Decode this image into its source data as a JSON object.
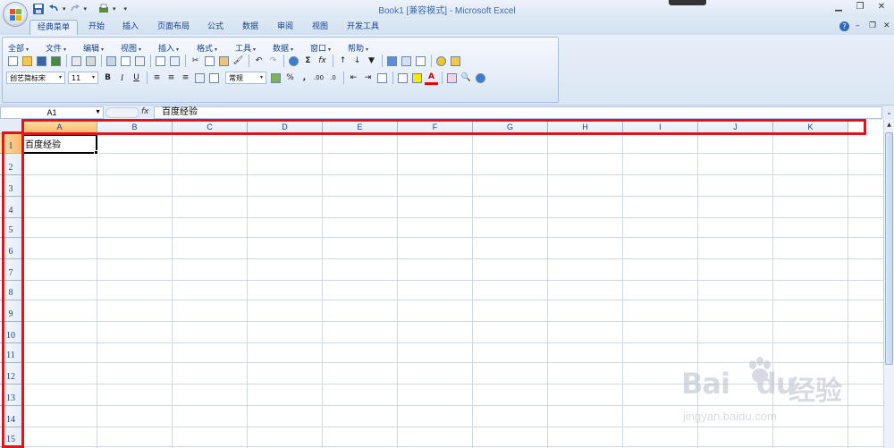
{
  "window": {
    "title": "Book1  [兼容模式] - ",
    "brand": "Microsoft Excel",
    "minimize": "▁",
    "restore": "❐",
    "close": "✕"
  },
  "ribbon_tabs": [
    "经典菜单",
    "开始",
    "插入",
    "页面布局",
    "公式",
    "数据",
    "审阅",
    "视图",
    "开发工具"
  ],
  "ribbon_right": {
    "help": "?",
    "min": "–",
    "restore": "❐",
    "close": "✕"
  },
  "menu": [
    "全部",
    "文件",
    "编辑",
    "视图",
    "插入",
    "格式",
    "工具",
    "数据",
    "窗口",
    "帮助"
  ],
  "formatting": {
    "font": "创艺简标宋",
    "size": "11",
    "bold": "B",
    "italic": "I",
    "underline": "U",
    "number_format": "常规",
    "percent": "%",
    "comma": ",",
    "inc_decimal": ".00",
    "dec_decimal": ".0"
  },
  "formula_bar": {
    "name_box": "A1",
    "fx": "fx",
    "content": "百度经验"
  },
  "grid": {
    "columns": [
      "A",
      "B",
      "C",
      "D",
      "E",
      "F",
      "G",
      "H",
      "I",
      "J",
      "K"
    ],
    "rows": [
      "1",
      "2",
      "3",
      "4",
      "5",
      "6",
      "7",
      "8",
      "9",
      "10",
      "11",
      "12",
      "13",
      "14",
      "15"
    ],
    "active_column": "A",
    "active_row": "1",
    "cells": {
      "A1": "百度经验"
    }
  },
  "watermark": {
    "logo": "Bai",
    "logo2": "du",
    "jingyan": "经验",
    "url": "jingyan.baidu.com"
  },
  "colors": {
    "annotation": "#e2141b",
    "header_active": "#f8b86a",
    "ribbon": "#dbe6f4"
  }
}
